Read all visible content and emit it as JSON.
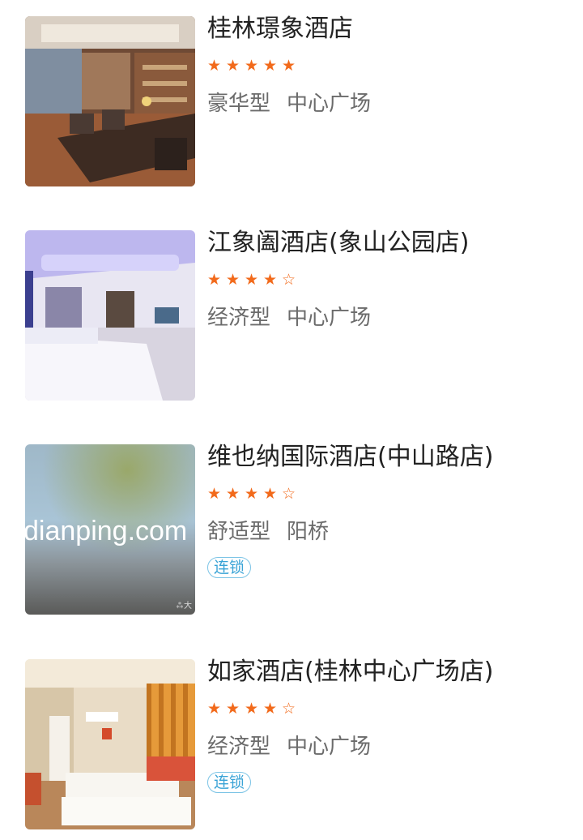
{
  "hotels": [
    {
      "name": "桂林璟象酒店",
      "stars": 5,
      "grade": "豪华型",
      "area": "中心广场",
      "tag": ""
    },
    {
      "name": "江象阖酒店(象山公园店)",
      "stars": 4,
      "grade": "经济型",
      "area": "中心广场",
      "tag": ""
    },
    {
      "name": "维也纳国际酒店(中山路店)",
      "stars": 4,
      "grade": "舒适型",
      "area": "阳桥",
      "tag": "连锁",
      "watermark": "dianping.com"
    },
    {
      "name": "如家酒店(桂林中心广场店)",
      "stars": 4,
      "grade": "经济型",
      "area": "中心广场",
      "tag": "连锁"
    }
  ],
  "colors": {
    "star": "#f26a1b",
    "tag": "#39a3d6",
    "title": "#222222",
    "meta": "#6b6b6b"
  },
  "icons": {
    "filled_star": "star-filled-icon",
    "empty_star": "star-outline-icon"
  }
}
